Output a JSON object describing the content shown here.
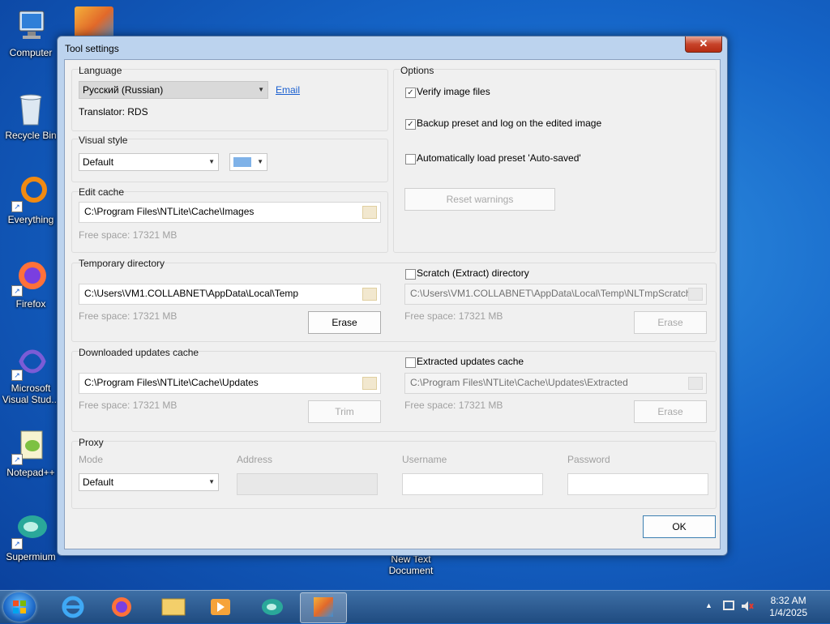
{
  "desktop": {
    "icons": [
      "Computer",
      "Recycle Bin",
      "Everything",
      "Firefox",
      "Microsoft Visual Stud...",
      "Notepad++",
      "Supermium"
    ],
    "file_label": "New Text Document"
  },
  "window": {
    "title": "Tool settings",
    "close_glyph": "✕",
    "language": {
      "group_label": "Language",
      "selected": "Русский (Russian)",
      "email_link": "Email",
      "translator": "Translator: RDS"
    },
    "visual_style": {
      "group_label": "Visual style",
      "selected": "Default",
      "swatch_color": "#7fb2e8"
    },
    "edit_cache": {
      "group_label": "Edit cache",
      "path": "C:\\Program Files\\NTLite\\Cache\\Images",
      "free_space": "Free space: 17321 MB"
    },
    "options": {
      "group_label": "Options",
      "verify": "Verify image files",
      "backup": "Backup preset and log on the edited image",
      "autoload": "Automatically load preset 'Auto-saved'",
      "reset_btn": "Reset warnings"
    },
    "temp_dir": {
      "group_label": "Temporary directory",
      "path": "C:\\Users\\VM1.COLLABNET\\AppData\\Local\\Temp",
      "free_space": "Free space: 17321 MB",
      "erase_btn": "Erase"
    },
    "scratch_dir": {
      "label": "Scratch (Extract) directory",
      "path": "C:\\Users\\VM1.COLLABNET\\AppData\\Local\\Temp\\NLTmpScratch",
      "free_space": "Free space: 17321 MB",
      "erase_btn": "Erase"
    },
    "updates_cache": {
      "group_label": "Downloaded updates cache",
      "path": "C:\\Program Files\\NTLite\\Cache\\Updates",
      "free_space": "Free space: 17321 MB",
      "trim_btn": "Trim"
    },
    "extracted_cache": {
      "label": "Extracted updates cache",
      "path": "C:\\Program Files\\NTLite\\Cache\\Updates\\Extracted",
      "free_space": "Free space: 17321 MB",
      "erase_btn": "Erase"
    },
    "proxy": {
      "group_label": "Proxy",
      "mode_label": "Mode",
      "mode_value": "Default",
      "address_label": "Address",
      "username_label": "Username",
      "password_label": "Password"
    },
    "ok_btn": "OK"
  },
  "taskbar": {
    "time": "8:32 AM",
    "date": "1/4/2025",
    "tray_arrow": "▲"
  },
  "glyphs": {
    "checked": "✓",
    "dropdown": "▼"
  }
}
